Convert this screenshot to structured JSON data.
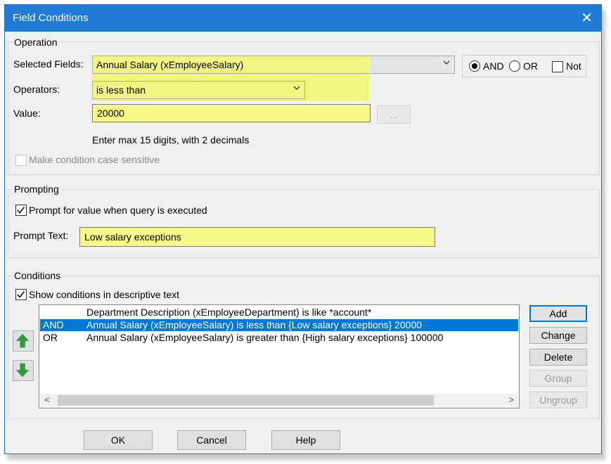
{
  "dialog": {
    "title": "Field Conditions",
    "close_icon": "close-icon"
  },
  "operation": {
    "legend": "Operation",
    "selected_fields_label": "Selected Fields:",
    "selected_field_value": "Annual Salary (xEmployeeSalary)",
    "operators_label": "Operators:",
    "operator_value": "is less than",
    "value_label": "Value:",
    "value": "20000",
    "browse_label": "...",
    "hint": "Enter max 15 digits, with 2 decimals",
    "case_sensitive_label": "Make condition case sensitive",
    "case_sensitive_checked": false,
    "and_label": "AND",
    "or_label": "OR",
    "not_label": "Not",
    "logic_selected": "AND",
    "not_checked": false
  },
  "prompting": {
    "legend": "Prompting",
    "prompt_checkbox_label": "Prompt for value when query is executed",
    "prompt_checked": true,
    "prompt_text_label": "Prompt Text:",
    "prompt_text_value": "Low salary exceptions"
  },
  "conditions": {
    "legend": "Conditions",
    "show_descriptive_label": "Show conditions in descriptive text",
    "show_descriptive_checked": true,
    "rows": [
      {
        "op": "",
        "text": "Department Description (xEmployeeDepartment) is like *account*",
        "selected": false
      },
      {
        "op": "AND",
        "text": "Annual Salary (xEmployeeSalary) is less than {Low salary exceptions} 20000",
        "selected": true
      },
      {
        "op": "OR",
        "text": "Annual Salary (xEmployeeSalary) is greater than {High salary exceptions} 100000",
        "selected": false
      }
    ],
    "buttons": {
      "add": "Add",
      "change": "Change",
      "delete": "Delete",
      "group": "Group",
      "ungroup": "Ungroup"
    },
    "move_up_icon": "arrow-up-icon",
    "move_down_icon": "arrow-down-icon"
  },
  "footer": {
    "ok": "OK",
    "cancel": "Cancel",
    "help": "Help"
  },
  "colors": {
    "titlebar": "#1f7bd6",
    "highlight": "#f2f57f",
    "selection": "#0078d7",
    "arrow_green": "#2e9c3a"
  }
}
